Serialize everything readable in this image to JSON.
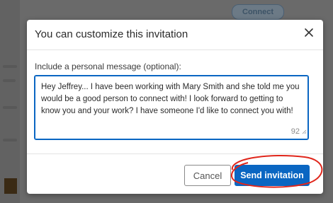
{
  "background": {
    "connect_label": "Connect"
  },
  "modal": {
    "title": "You can customize this invitation",
    "close_icon": "close-icon",
    "message_label": "Include a personal message (optional):",
    "message_text": "Hey Jeffrey... I have been working with Mary Smith and she told me you would be a good person to connect with! I look forward to getting to know you and your work? I have someone I'd like to connect you with!",
    "char_count": "92",
    "cancel_label": "Cancel",
    "send_label": "Send invitation"
  },
  "colors": {
    "primary_button": "#0a66c2",
    "highlight_annotation": "#e0261b"
  }
}
